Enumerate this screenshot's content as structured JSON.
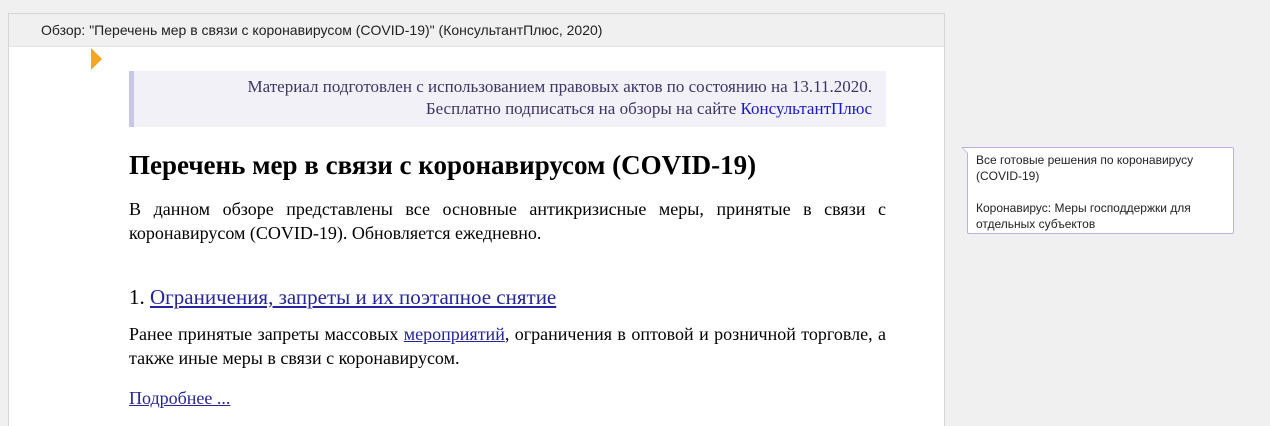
{
  "header": {
    "title": "Обзор: \"Перечень мер в связи с коронавирусом (COVID-19)\" (КонсультантПлюс, 2020)"
  },
  "notice": {
    "line1": "Материал подготовлен с использованием правовых актов по состоянию на 13.11.2020.",
    "line2_prefix": "Бесплатно подписаться на обзоры на сайте ",
    "line2_link": "КонсультантПлюс"
  },
  "document": {
    "title": "Перечень мер в связи с коронавирусом (COVID-19)",
    "intro": "В данном обзоре представлены все основные антикризисные меры, принятые в связи с коронавирусом (COVID-19). Обновляется ежедневно.",
    "section1": {
      "number": "1. ",
      "link": "Ограничения, запреты и их поэтапное снятие",
      "text_prefix": "Ранее принятые запреты массовых ",
      "text_link": "мероприятий",
      "text_suffix": ", ограничения в оптовой и розничной торговле, а также иные меры в связи с коронавирусом.",
      "more": "Подробнее ..."
    }
  },
  "side_panel": {
    "links": [
      "Все готовые решения по коронавирусу (COVID-19)",
      "Коронавирус: Меры господдержки для отдельных субъектов"
    ]
  },
  "colors": {
    "marker": "#f6a623",
    "link": "#24249c",
    "notice_bg": "#f1f1f7",
    "notice_border": "#c8c8e6"
  }
}
